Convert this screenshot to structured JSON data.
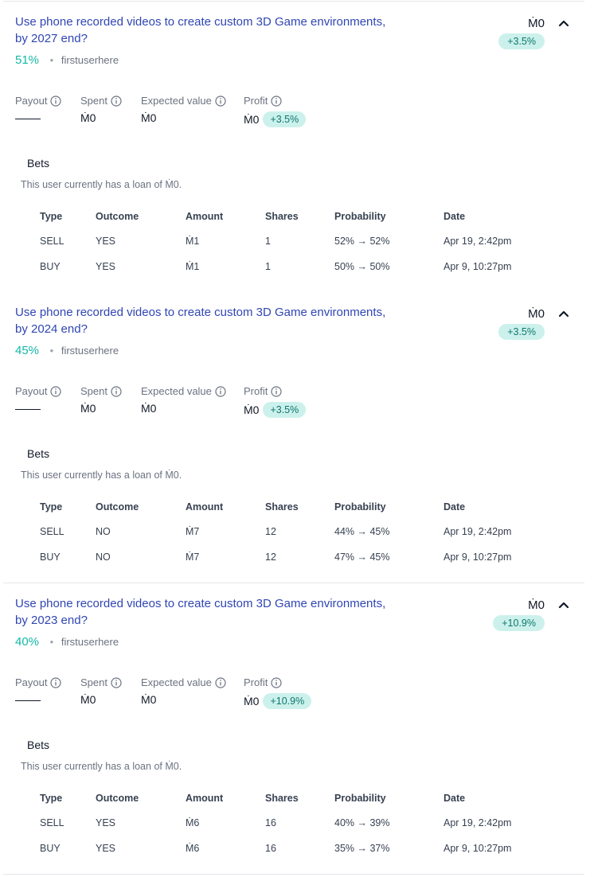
{
  "markets": [
    {
      "title": "Use phone recorded videos to create custom 3D Game environments, by 2027 end?",
      "probability": "51%",
      "creator": "firstuserhere",
      "value": "Ṁ0",
      "change": "+3.5%",
      "stats": {
        "payout_label": "Payout",
        "payout_value": "——",
        "spent_label": "Spent",
        "spent_value": "Ṁ0",
        "ev_label": "Expected value",
        "ev_value": "Ṁ0",
        "profit_label": "Profit",
        "profit_value": "Ṁ0",
        "profit_change": "+3.5%"
      },
      "bets_heading": "Bets",
      "loan_text": "This user currently has a loan of Ṁ0.",
      "columns": [
        "Type",
        "Outcome",
        "Amount",
        "Shares",
        "Probability",
        "Date"
      ],
      "rows": [
        {
          "type": "SELL",
          "outcome": "YES",
          "amount": "Ṁ1",
          "shares": "1",
          "probability": "52% → 52%",
          "date": "Apr 19, 2:42pm"
        },
        {
          "type": "BUY",
          "outcome": "YES",
          "amount": "Ṁ1",
          "shares": "1",
          "probability": "50% → 50%",
          "date": "Apr 9, 10:27pm"
        }
      ]
    },
    {
      "title": "Use phone recorded videos to create custom 3D Game environments, by 2024 end?",
      "probability": "45%",
      "creator": "firstuserhere",
      "value": "Ṁ0",
      "change": "+3.5%",
      "stats": {
        "payout_label": "Payout",
        "payout_value": "——",
        "spent_label": "Spent",
        "spent_value": "Ṁ0",
        "ev_label": "Expected value",
        "ev_value": "Ṁ0",
        "profit_label": "Profit",
        "profit_value": "Ṁ0",
        "profit_change": "+3.5%"
      },
      "bets_heading": "Bets",
      "loan_text": "This user currently has a loan of Ṁ0.",
      "columns": [
        "Type",
        "Outcome",
        "Amount",
        "Shares",
        "Probability",
        "Date"
      ],
      "rows": [
        {
          "type": "SELL",
          "outcome": "NO",
          "amount": "Ṁ7",
          "shares": "12",
          "probability": "44% → 45%",
          "date": "Apr 19, 2:42pm"
        },
        {
          "type": "BUY",
          "outcome": "NO",
          "amount": "Ṁ7",
          "shares": "12",
          "probability": "47% → 45%",
          "date": "Apr 9, 10:27pm"
        }
      ]
    },
    {
      "title": "Use phone recorded videos to create custom 3D Game environments, by 2023 end?",
      "probability": "40%",
      "creator": "firstuserhere",
      "value": "Ṁ0",
      "change": "+10.9%",
      "stats": {
        "payout_label": "Payout",
        "payout_value": "——",
        "spent_label": "Spent",
        "spent_value": "Ṁ0",
        "ev_label": "Expected value",
        "ev_value": "Ṁ0",
        "profit_label": "Profit",
        "profit_value": "Ṁ0",
        "profit_change": "+10.9%"
      },
      "bets_heading": "Bets",
      "loan_text": "This user currently has a loan of Ṁ0.",
      "columns": [
        "Type",
        "Outcome",
        "Amount",
        "Shares",
        "Probability",
        "Date"
      ],
      "rows": [
        {
          "type": "SELL",
          "outcome": "YES",
          "amount": "Ṁ6",
          "shares": "16",
          "probability": "40% → 39%",
          "date": "Apr 19, 2:42pm"
        },
        {
          "type": "BUY",
          "outcome": "YES",
          "amount": "Ṁ6",
          "shares": "16",
          "probability": "35% → 37%",
          "date": "Apr 9, 10:27pm"
        }
      ]
    }
  ],
  "colors": {
    "title_link": "#3046b3",
    "probability": "#14b8a6",
    "yes": "#14866d",
    "no": "#dc2626",
    "badge_bg": "#ccf1ec",
    "badge_text": "#0f766e"
  },
  "icons": {
    "info": "info-icon",
    "collapse": "chevron-up-icon"
  }
}
